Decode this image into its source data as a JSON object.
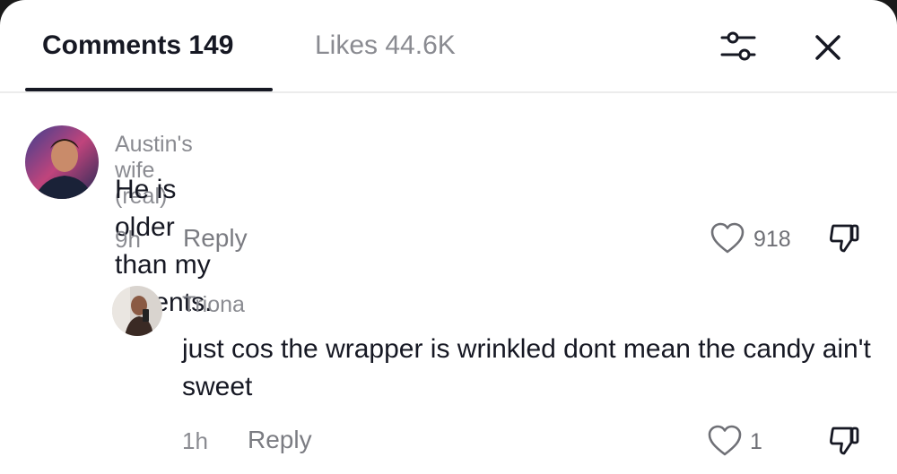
{
  "tabs": {
    "comments_label": "Comments 149",
    "likes_label": "Likes 44.6K"
  },
  "comments": [
    {
      "username": "Austin's wife (real)",
      "text": "He is older than my parents.",
      "time": "9h",
      "reply_label": "Reply",
      "likes": "918"
    }
  ],
  "replies": [
    {
      "username": "Triona",
      "text": "just cos the wrapper is wrinkled dont mean the candy ain't sweet",
      "time": "1h",
      "reply_label": "Reply",
      "likes": "1"
    }
  ],
  "icons": {
    "filter": "filter-sliders-icon",
    "close": "close-icon",
    "like": "heart-icon",
    "dislike": "thumbs-down-icon"
  },
  "colors": {
    "text_primary": "#161823",
    "text_secondary": "#8a8b91",
    "divider": "#ececec"
  }
}
